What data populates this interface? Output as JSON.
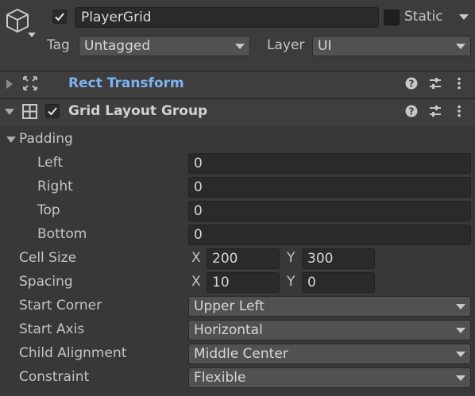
{
  "header": {
    "object_icon": "cube-icon",
    "active": true,
    "name": "PlayerGrid",
    "static_label": "Static",
    "static_checked": false,
    "tag_label": "Tag",
    "tag_value": "Untagged",
    "layer_label": "Layer",
    "layer_value": "UI"
  },
  "rect_transform": {
    "title": "Rect Transform",
    "title_color": "#7fb2f0",
    "icon": "rect-transform-icon"
  },
  "grid_layout_group": {
    "title": "Grid Layout Group",
    "enabled": true,
    "icon": "grid-icon",
    "padding": {
      "label": "Padding",
      "left_label": "Left",
      "left": "0",
      "right_label": "Right",
      "right": "0",
      "top_label": "Top",
      "top": "0",
      "bottom_label": "Bottom",
      "bottom": "0"
    },
    "cell_size": {
      "label": "Cell Size",
      "x_label": "X",
      "x": "200",
      "y_label": "Y",
      "y": "300"
    },
    "spacing": {
      "label": "Spacing",
      "x_label": "X",
      "x": "10",
      "y_label": "Y",
      "y": "0"
    },
    "start_corner": {
      "label": "Start Corner",
      "value": "Upper Left"
    },
    "start_axis": {
      "label": "Start Axis",
      "value": "Horizontal"
    },
    "child_alignment": {
      "label": "Child Alignment",
      "value": "Middle Center"
    },
    "constraint": {
      "label": "Constraint",
      "value": "Flexible"
    }
  },
  "toolbar_icons": [
    "help-icon",
    "preset-icon",
    "more-icon"
  ]
}
